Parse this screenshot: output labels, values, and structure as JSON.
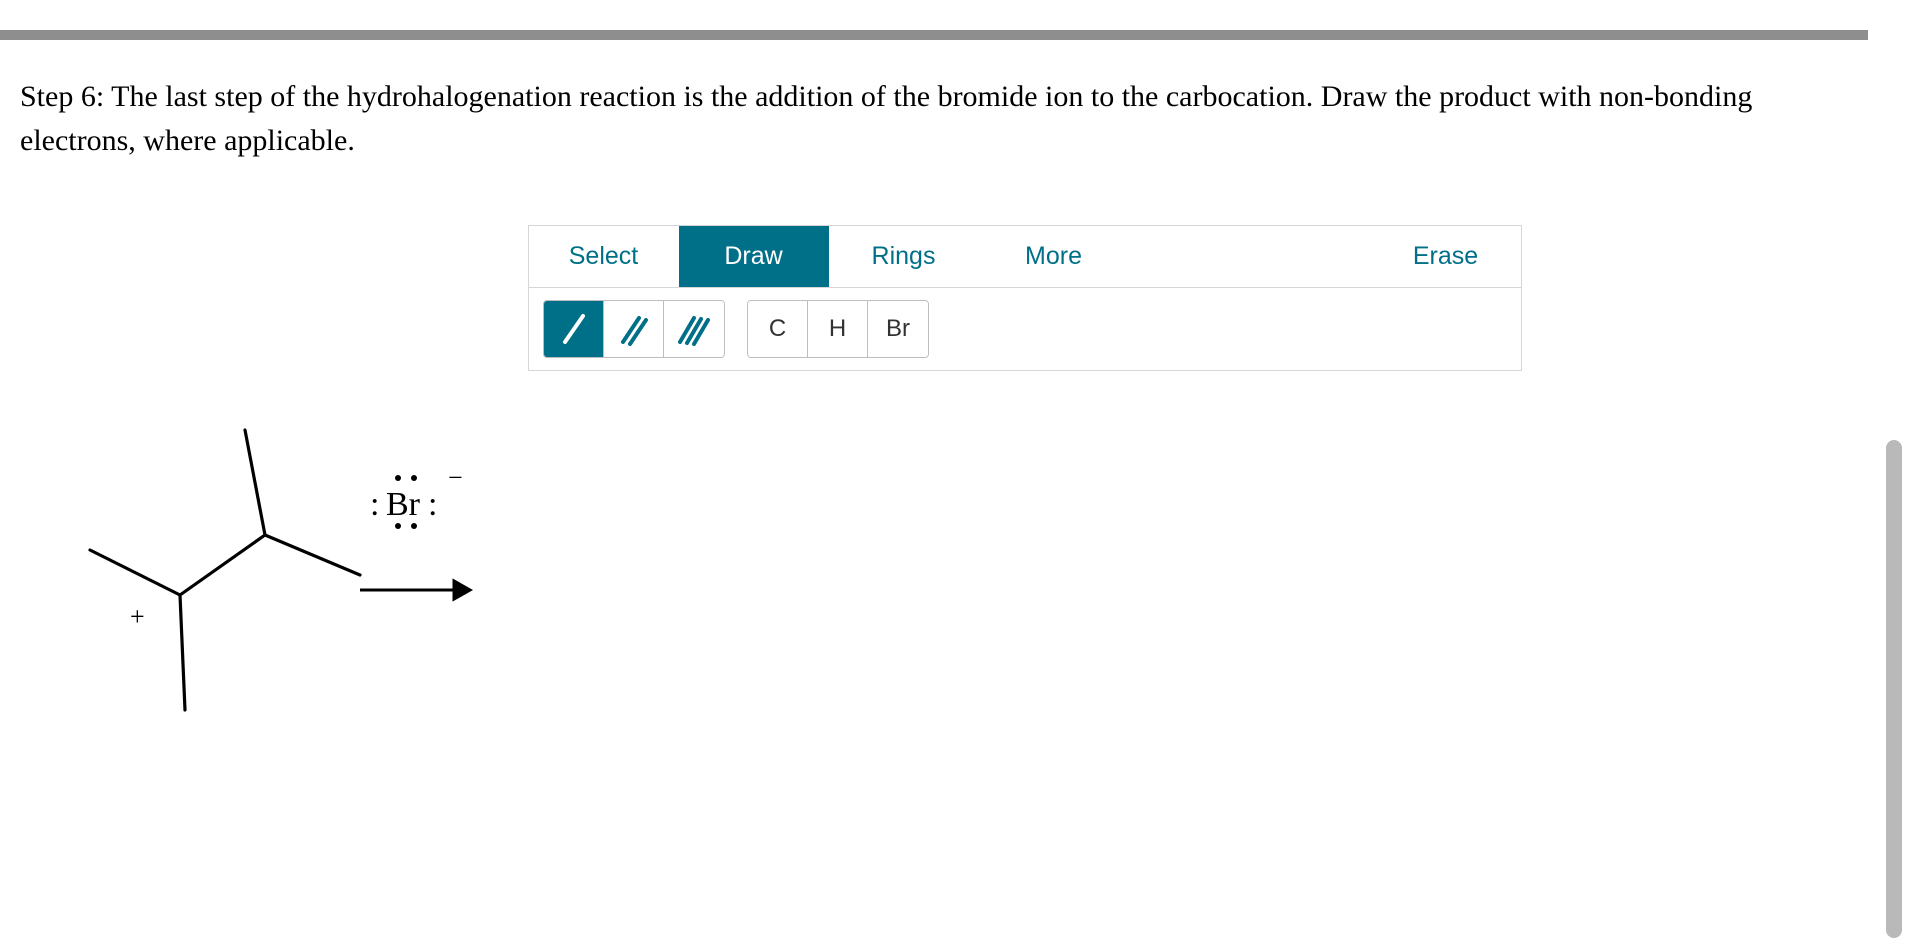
{
  "question": {
    "text": "Step 6: The last step of the hydrohalogenation reaction is the addition of the bromide ion to the carbocation. Draw the product with non-bonding electrons, where applicable."
  },
  "reactant": {
    "bromide_label": "Br",
    "charge_minus": "−",
    "cation_charge": "+"
  },
  "toolbar": {
    "tabs": {
      "select": "Select",
      "draw": "Draw",
      "rings": "Rings",
      "more": "More",
      "erase": "Erase"
    },
    "elements": {
      "c": "C",
      "h": "H",
      "br": "Br"
    }
  }
}
